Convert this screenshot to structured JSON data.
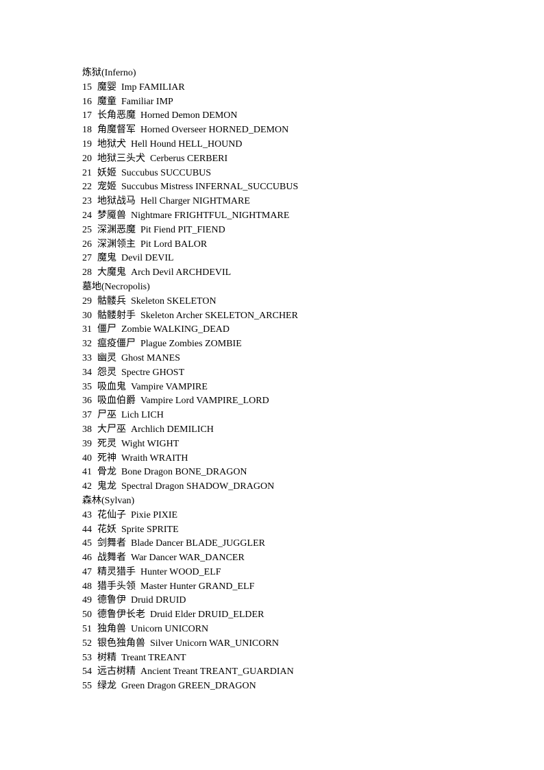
{
  "sections": [
    {
      "heading": "炼狱(Inferno)",
      "items": [
        {
          "num": "15",
          "cn": "魔婴",
          "en": "Imp FAMILIAR"
        },
        {
          "num": "16",
          "cn": "魔童",
          "en": "Familiar IMP"
        },
        {
          "num": "17",
          "cn": "长角恶魔",
          "en": "Horned Demon DEMON"
        },
        {
          "num": "18",
          "cn": "角魔督军",
          "en": "Horned Overseer HORNED_DEMON"
        },
        {
          "num": "19",
          "cn": "地狱犬",
          "en": "Hell Hound HELL_HOUND"
        },
        {
          "num": "20",
          "cn": "地狱三头犬",
          "en": "Cerberus CERBERI"
        },
        {
          "num": "21",
          "cn": "妖姬",
          "en": "Succubus SUCCUBUS"
        },
        {
          "num": "22",
          "cn": "宠姬",
          "en": "Succubus Mistress INFERNAL_SUCCUBUS"
        },
        {
          "num": "23",
          "cn": "地狱战马",
          "en": "Hell Charger NIGHTMARE"
        },
        {
          "num": "24",
          "cn": "梦魇兽",
          "en": "Nightmare FRIGHTFUL_NIGHTMARE"
        },
        {
          "num": "25",
          "cn": "深渊恶魔",
          "en": "Pit Fiend PIT_FIEND"
        },
        {
          "num": "26",
          "cn": "深渊领主",
          "en": "Pit Lord BALOR"
        },
        {
          "num": "27",
          "cn": "魔鬼",
          "en": "Devil DEVIL"
        },
        {
          "num": "28",
          "cn": "大魔鬼",
          "en": "Arch Devil ARCHDEVIL"
        }
      ]
    },
    {
      "heading": "墓地(Necropolis)",
      "items": [
        {
          "num": "29",
          "cn": "骷髅兵",
          "en": "Skeleton SKELETON"
        },
        {
          "num": "30",
          "cn": "骷髅射手",
          "en": "Skeleton Archer SKELETON_ARCHER"
        },
        {
          "num": "31",
          "cn": "僵尸",
          "en": "Zombie WALKING_DEAD"
        },
        {
          "num": "32",
          "cn": "瘟疫僵尸",
          "en": "Plague Zombies ZOMBIE"
        },
        {
          "num": "33",
          "cn": "幽灵",
          "en": "Ghost MANES"
        },
        {
          "num": "34",
          "cn": "怨灵",
          "en": "Spectre GHOST"
        },
        {
          "num": "35",
          "cn": "吸血鬼",
          "en": "Vampire VAMPIRE"
        },
        {
          "num": "36",
          "cn": "吸血伯爵",
          "en": "Vampire Lord VAMPIRE_LORD"
        },
        {
          "num": "37",
          "cn": "尸巫",
          "en": "Lich LICH"
        },
        {
          "num": "38",
          "cn": "大尸巫",
          "en": "Archlich DEMILICH"
        },
        {
          "num": "39",
          "cn": "死灵",
          "en": "Wight WIGHT"
        },
        {
          "num": "40",
          "cn": "死神",
          "en": "Wraith WRAITH"
        },
        {
          "num": "41",
          "cn": "骨龙",
          "en": "Bone Dragon BONE_DRAGON"
        },
        {
          "num": "42",
          "cn": "鬼龙",
          "en": "Spectral Dragon SHADOW_DRAGON"
        }
      ]
    },
    {
      "heading": "森林(Sylvan)",
      "items": [
        {
          "num": "43",
          "cn": "花仙子",
          "en": "Pixie PIXIE"
        },
        {
          "num": "44",
          "cn": "花妖",
          "en": "Sprite SPRITE"
        },
        {
          "num": "45",
          "cn": "剑舞者",
          "en": "Blade Dancer BLADE_JUGGLER"
        },
        {
          "num": "46",
          "cn": "战舞者",
          "en": "War Dancer WAR_DANCER"
        },
        {
          "num": "47",
          "cn": "精灵猎手",
          "en": "Hunter WOOD_ELF"
        },
        {
          "num": "48",
          "cn": "猎手头领",
          "en": "Master Hunter GRAND_ELF"
        },
        {
          "num": "49",
          "cn": "德鲁伊",
          "en": "Druid DRUID"
        },
        {
          "num": "50",
          "cn": "德鲁伊长老",
          "en": "Druid Elder DRUID_ELDER"
        },
        {
          "num": "51",
          "cn": "独角兽",
          "en": "Unicorn UNICORN"
        },
        {
          "num": "52",
          "cn": "银色独角兽",
          "en": "Silver Unicorn WAR_UNICORN"
        },
        {
          "num": "53",
          "cn": "树精",
          "en": "Treant TREANT"
        },
        {
          "num": "54",
          "cn": "远古树精",
          "en": "Ancient Treant TREANT_GUARDIAN"
        },
        {
          "num": "55",
          "cn": "绿龙",
          "en": "Green Dragon GREEN_DRAGON"
        }
      ]
    }
  ]
}
